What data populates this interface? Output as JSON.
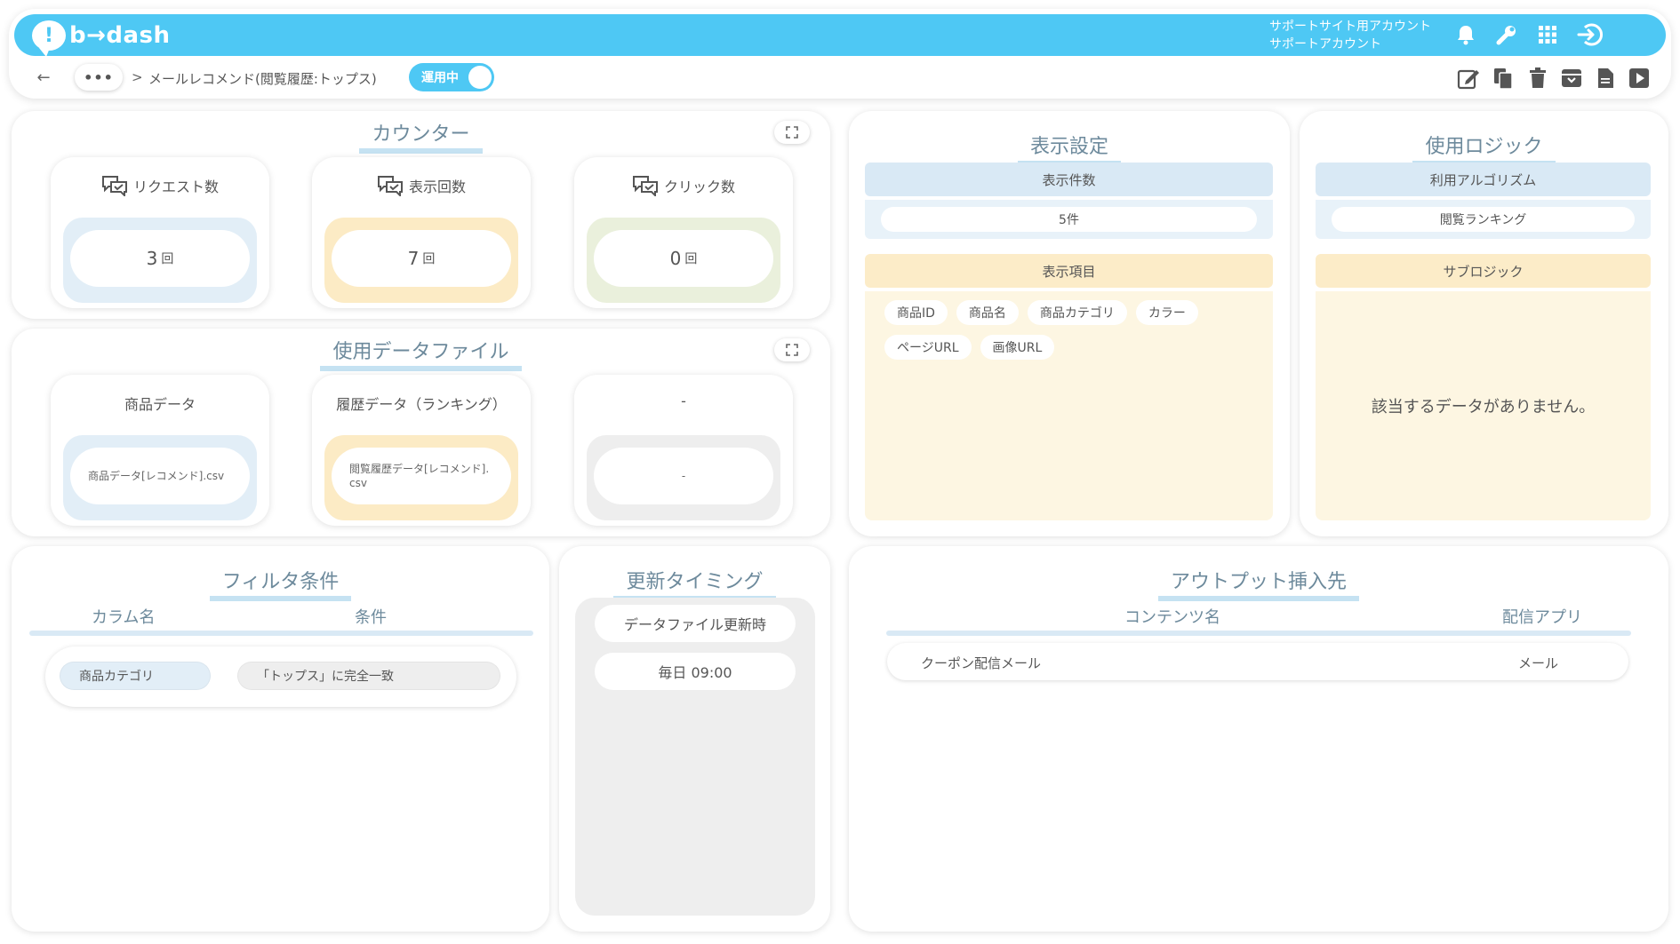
{
  "header": {
    "logo_mark": "!",
    "logo_text": "b→dash",
    "account_line1": "サポートサイト用アカウント",
    "account_line2": "サポートアカウント",
    "icons": [
      "bell-icon",
      "wrench-icon",
      "grid-icon",
      "logout-icon"
    ],
    "brand_color": "#4ec8f4"
  },
  "subbar": {
    "back_glyph": "←",
    "more_glyph": "•••",
    "separator": ">",
    "breadcrumb": "メールレコメンド(閲覧履歴:トップス)",
    "status_label": "運用中",
    "tool_icons": [
      "edit-icon",
      "copy-icon",
      "delete-icon",
      "archive-icon",
      "document-icon",
      "play-icon"
    ]
  },
  "counter": {
    "title": "カウンター",
    "tiles": [
      {
        "label": "リクエスト数",
        "value": "3",
        "unit": "回"
      },
      {
        "label": "表示回数",
        "value": "7",
        "unit": "回"
      },
      {
        "label": "クリック数",
        "value": "0",
        "unit": "回"
      }
    ]
  },
  "datafile": {
    "title": "使用データファイル",
    "tiles": [
      {
        "label": "商品データ",
        "file": "商品データ[レコメンド].csv"
      },
      {
        "label": "履歴データ（ランキング）",
        "file": "閲覧履歴データ[レコメンド].csv"
      },
      {
        "label": "-",
        "file": "-"
      }
    ]
  },
  "display": {
    "title": "表示設定",
    "count_label": "表示件数",
    "count_value": "5件",
    "items_label": "表示項目",
    "items": [
      "商品ID",
      "商品名",
      "商品カテゴリ",
      "カラー",
      "ページURL",
      "画像URL"
    ]
  },
  "logic": {
    "title": "使用ロジック",
    "algorithm_label": "利用アルゴリズム",
    "algorithm_value": "閲覧ランキング",
    "sublogic_label": "サブロジック",
    "empty_message": "該当するデータがありません。"
  },
  "filter": {
    "title": "フィルタ条件",
    "col_header": "カラム名",
    "cond_header": "条件",
    "rows": [
      {
        "column": "商品カテゴリ",
        "condition": "「トップス」に完全一致"
      }
    ]
  },
  "timing": {
    "title": "更新タイミング",
    "items": [
      "データファイル更新時",
      "毎日 09:00"
    ]
  },
  "output": {
    "title": "アウトプット挿入先",
    "col_content": "コンテンツ名",
    "col_app": "配信アプリ",
    "rows": [
      {
        "content": "クーポン配信メール",
        "app": "メール"
      }
    ]
  }
}
